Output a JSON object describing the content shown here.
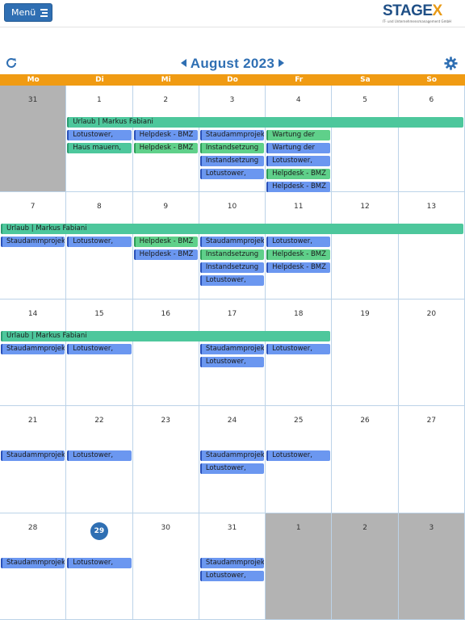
{
  "app": {
    "menu_label": "Menü",
    "logo_text_main": "STAGE",
    "logo_text_x": "X",
    "logo_tagline": "IT- und Unternehmensmanagement GmbH"
  },
  "calendar": {
    "month_title": "August 2023",
    "weekdays": [
      "Mo",
      "Di",
      "Mi",
      "Do",
      "Fr",
      "Sa",
      "So"
    ],
    "weeks": [
      [
        {
          "d": "31",
          "out": true
        },
        {
          "d": "1"
        },
        {
          "d": "2"
        },
        {
          "d": "3"
        },
        {
          "d": "4"
        },
        {
          "d": "5"
        },
        {
          "d": "6"
        }
      ],
      [
        {
          "d": "7"
        },
        {
          "d": "8"
        },
        {
          "d": "9"
        },
        {
          "d": "10"
        },
        {
          "d": "11"
        },
        {
          "d": "12"
        },
        {
          "d": "13"
        }
      ],
      [
        {
          "d": "14"
        },
        {
          "d": "15"
        },
        {
          "d": "16"
        },
        {
          "d": "17"
        },
        {
          "d": "18"
        },
        {
          "d": "19"
        },
        {
          "d": "20"
        }
      ],
      [
        {
          "d": "21"
        },
        {
          "d": "22"
        },
        {
          "d": "23"
        },
        {
          "d": "24"
        },
        {
          "d": "25"
        },
        {
          "d": "26"
        },
        {
          "d": "27"
        }
      ],
      [
        {
          "d": "28"
        },
        {
          "d": "29",
          "today": true
        },
        {
          "d": "30"
        },
        {
          "d": "31"
        },
        {
          "d": "1",
          "out": true
        },
        {
          "d": "2",
          "out": true
        },
        {
          "d": "3",
          "out": true
        }
      ]
    ],
    "events": [
      {
        "week": 0,
        "start": 1,
        "span": 6,
        "slot": 0,
        "label": "Urlaub | Markus Fabiani",
        "color": "teal"
      },
      {
        "week": 0,
        "start": 1,
        "span": 1,
        "slot": 1,
        "label": "Lotustower,",
        "color": "blue"
      },
      {
        "week": 0,
        "start": 2,
        "span": 1,
        "slot": 1,
        "label": "Helpdesk - BMZ",
        "color": "blue"
      },
      {
        "week": 0,
        "start": 3,
        "span": 1,
        "slot": 1,
        "label": "Staudammprojekt",
        "color": "blue"
      },
      {
        "week": 0,
        "start": 4,
        "span": 1,
        "slot": 1,
        "label": "Wartung der",
        "color": "green"
      },
      {
        "week": 0,
        "start": 1,
        "span": 1,
        "slot": 2,
        "label": "Haus mauern,",
        "color": "teal"
      },
      {
        "week": 0,
        "start": 2,
        "span": 1,
        "slot": 2,
        "label": "Helpdesk - BMZ",
        "color": "green"
      },
      {
        "week": 0,
        "start": 3,
        "span": 1,
        "slot": 2,
        "label": "Instandsetzung",
        "color": "green"
      },
      {
        "week": 0,
        "start": 4,
        "span": 1,
        "slot": 2,
        "label": "Wartung der",
        "color": "blue"
      },
      {
        "week": 0,
        "start": 3,
        "span": 1,
        "slot": 3,
        "label": "Instandsetzung",
        "color": "blue"
      },
      {
        "week": 0,
        "start": 4,
        "span": 1,
        "slot": 3,
        "label": "Lotustower,",
        "color": "blue"
      },
      {
        "week": 0,
        "start": 3,
        "span": 1,
        "slot": 4,
        "label": "Lotustower,",
        "color": "blue"
      },
      {
        "week": 0,
        "start": 4,
        "span": 1,
        "slot": 4,
        "label": "Helpdesk - BMZ",
        "color": "green"
      },
      {
        "week": 0,
        "start": 4,
        "span": 1,
        "slot": 5,
        "label": "Helpdesk - BMZ",
        "color": "blue"
      },
      {
        "week": 1,
        "start": 0,
        "span": 7,
        "slot": 0,
        "label": "Urlaub | Markus Fabiani",
        "color": "teal"
      },
      {
        "week": 1,
        "start": 0,
        "span": 1,
        "slot": 1,
        "label": "Staudammprojekt",
        "color": "blue"
      },
      {
        "week": 1,
        "start": 1,
        "span": 1,
        "slot": 1,
        "label": "Lotustower,",
        "color": "blue"
      },
      {
        "week": 1,
        "start": 2,
        "span": 1,
        "slot": 1,
        "label": "Helpdesk - BMZ",
        "color": "green"
      },
      {
        "week": 1,
        "start": 3,
        "span": 1,
        "slot": 1,
        "label": "Staudammprojekt",
        "color": "blue"
      },
      {
        "week": 1,
        "start": 4,
        "span": 1,
        "slot": 1,
        "label": "Lotustower,",
        "color": "blue"
      },
      {
        "week": 1,
        "start": 2,
        "span": 1,
        "slot": 2,
        "label": "Helpdesk - BMZ",
        "color": "blue"
      },
      {
        "week": 1,
        "start": 3,
        "span": 1,
        "slot": 2,
        "label": "Instandsetzung",
        "color": "green"
      },
      {
        "week": 1,
        "start": 4,
        "span": 1,
        "slot": 2,
        "label": "Helpdesk - BMZ",
        "color": "green"
      },
      {
        "week": 1,
        "start": 3,
        "span": 1,
        "slot": 3,
        "label": "Instandsetzung",
        "color": "blue"
      },
      {
        "week": 1,
        "start": 4,
        "span": 1,
        "slot": 3,
        "label": "Helpdesk - BMZ",
        "color": "blue"
      },
      {
        "week": 1,
        "start": 3,
        "span": 1,
        "slot": 4,
        "label": "Lotustower,",
        "color": "blue"
      },
      {
        "week": 2,
        "start": 0,
        "span": 5,
        "slot": 0,
        "label": "Urlaub | Markus Fabiani",
        "color": "teal"
      },
      {
        "week": 2,
        "start": 0,
        "span": 1,
        "slot": 1,
        "label": "Staudammprojekt",
        "color": "blue"
      },
      {
        "week": 2,
        "start": 1,
        "span": 1,
        "slot": 1,
        "label": "Lotustower,",
        "color": "blue"
      },
      {
        "week": 2,
        "start": 3,
        "span": 1,
        "slot": 1,
        "label": "Staudammprojekt",
        "color": "blue"
      },
      {
        "week": 2,
        "start": 4,
        "span": 1,
        "slot": 1,
        "label": "Lotustower,",
        "color": "blue"
      },
      {
        "week": 2,
        "start": 3,
        "span": 1,
        "slot": 2,
        "label": "Lotustower,",
        "color": "blue"
      },
      {
        "week": 3,
        "start": 0,
        "span": 1,
        "slot": 1,
        "label": "Staudammprojekt",
        "color": "blue"
      },
      {
        "week": 3,
        "start": 1,
        "span": 1,
        "slot": 1,
        "label": "Lotustower,",
        "color": "blue"
      },
      {
        "week": 3,
        "start": 3,
        "span": 1,
        "slot": 1,
        "label": "Staudammprojekt",
        "color": "blue"
      },
      {
        "week": 3,
        "start": 4,
        "span": 1,
        "slot": 1,
        "label": "Lotustower,",
        "color": "blue"
      },
      {
        "week": 3,
        "start": 3,
        "span": 1,
        "slot": 2,
        "label": "Lotustower,",
        "color": "blue"
      },
      {
        "week": 4,
        "start": 0,
        "span": 1,
        "slot": 1,
        "label": "Staudammprojekt",
        "color": "blue"
      },
      {
        "week": 4,
        "start": 1,
        "span": 1,
        "slot": 1,
        "label": "Lotustower,",
        "color": "blue"
      },
      {
        "week": 4,
        "start": 3,
        "span": 1,
        "slot": 1,
        "label": "Staudammprojekt",
        "color": "blue"
      },
      {
        "week": 4,
        "start": 3,
        "span": 1,
        "slot": 2,
        "label": "Lotustower,",
        "color": "blue"
      }
    ]
  },
  "colors": {
    "accent": "#2f6fb3",
    "header_bg": "#f09b13",
    "event_blue": "#6b97f0",
    "event_green": "#5fd08a",
    "event_teal": "#4dc79c",
    "out_of_month": "#b3b3b3"
  },
  "icons": {
    "refresh": "refresh-icon",
    "settings": "gear-icon",
    "prev": "chevron-left-icon",
    "next": "chevron-right-icon",
    "menu": "menu-icon"
  }
}
